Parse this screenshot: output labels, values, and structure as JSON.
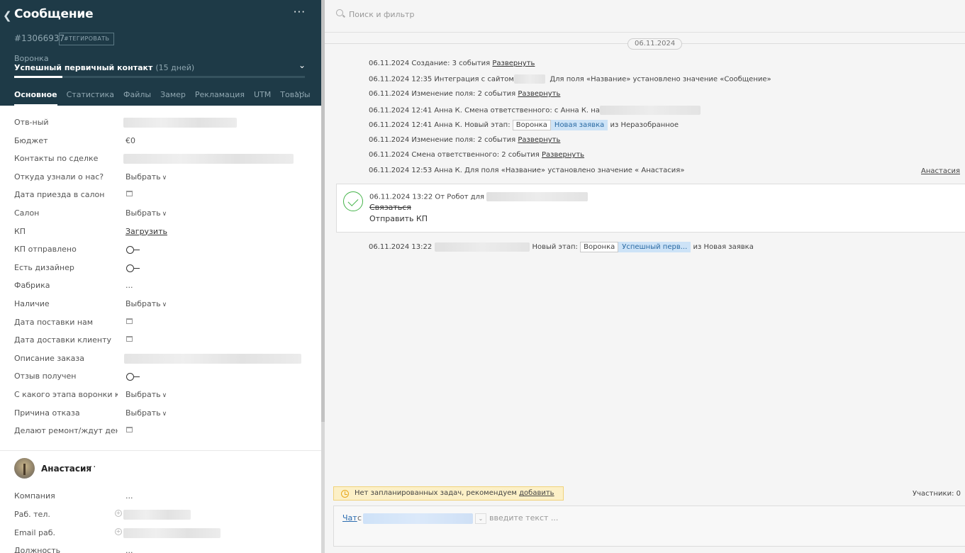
{
  "header": {
    "title": "Сообщение",
    "lead_id": "#13066937",
    "tag_button": "#ТЕГИРОВАТЬ",
    "pipeline_label": "Воронка",
    "stage": "Успешный первичный контакт",
    "stage_days": "(15 дней)",
    "stage_progress": 0.165,
    "more": "···"
  },
  "tabs": [
    "Основное",
    "Статистика",
    "Файлы",
    "Замер",
    "Рекламация",
    "UTM",
    "Товары"
  ],
  "tabs_more": "···",
  "fields": [
    {
      "label": "Отв-ный",
      "kind": "blur"
    },
    {
      "label": "Бюджет",
      "value": "€0",
      "kind": "text"
    },
    {
      "label": "Контакты по сделке",
      "kind": "blur"
    },
    {
      "label": "Откуда узнали о нас?",
      "value": "Выбрать",
      "kind": "select"
    },
    {
      "label": "Дата приезда в салон",
      "kind": "date"
    },
    {
      "label": "Салон",
      "value": "Выбрать",
      "kind": "select"
    },
    {
      "label": "КП",
      "value": "Загрузить",
      "kind": "link"
    },
    {
      "label": "КП отправлено",
      "kind": "toggle"
    },
    {
      "label": "Есть дизайнер",
      "kind": "toggle"
    },
    {
      "label": "Фабрика",
      "value": "...",
      "kind": "text"
    },
    {
      "label": "Наличие",
      "value": "Выбрать",
      "kind": "select"
    },
    {
      "label": "Дата поставки нам",
      "kind": "date"
    },
    {
      "label": "Дата доставки клиенту",
      "kind": "date"
    },
    {
      "label": "Описание заказа",
      "kind": "blur"
    },
    {
      "label": "Отзыв получен",
      "kind": "toggle"
    },
    {
      "label": "С какого этапа воронки кли",
      "value": "Выбрать",
      "kind": "select"
    },
    {
      "label": "Причина отказа",
      "value": "Выбрать",
      "kind": "select"
    },
    {
      "label": "Делают ремонт/ждут денег,",
      "kind": "date"
    }
  ],
  "contact": {
    "name": "Анастасия",
    "more": "···",
    "rows": [
      {
        "label": "Компания",
        "value": "..."
      },
      {
        "label": "Раб. тел.",
        "value": ""
      },
      {
        "label": "Email раб.",
        "value": ""
      },
      {
        "label": "Должность",
        "value": "..."
      }
    ]
  },
  "feed": {
    "search_placeholder": "Поиск и фильтр",
    "date": "06.11.2024",
    "events": {
      "e1_text": "06.11.2024 Создание: 3 события",
      "e1_link": "Развернуть",
      "e2_text": "06.11.2024 12:35 Интеграция с сайтом",
      "e2_tail": "Для поля «Название» установлено значение «Сообщение»",
      "e3_text": "06.11.2024 Изменение поля: 2 события",
      "e3_link": "Развернуть",
      "e4_text": "06.11.2024 12:41 Анна К. Смена ответственного: с Анна К. на",
      "e5_text": "06.11.2024 12:41 Анна К. Новый этап:",
      "e5_chip1": "Воронка",
      "e5_chip2": "Новая заявка",
      "e5_tail": "из Неразобранное",
      "e6_text": "06.11.2024 Изменение поля: 2 события",
      "e6_link": "Развернуть",
      "e7_text": "06.11.2024 Смена ответственного: 2 события",
      "e7_link": "Развернуть",
      "e8_text": "06.11.2024 12:53 Анна К. Для поля «Название» установлено значение « Анастасия»",
      "e8_right": "Анастасия",
      "e9_text": "06.11.2024 13:22",
      "e9_mid": "Новый этап:",
      "e9_chip1": "Воронка",
      "e9_chip2": "Успешный перв...",
      "e9_tail": "из Новая заявка"
    },
    "task": {
      "meta": "06.11.2024 13:22  От Робот для",
      "done": "Связаться",
      "todo": "Отправить КП"
    },
    "no_tasks_text": "Нет запланированных задач, рекомендуем",
    "no_tasks_link": "добавить",
    "participants": "Участники: 0",
    "chat_link": "Чат",
    "chat_with": "с",
    "chat_placeholder": "введите текст ..."
  }
}
